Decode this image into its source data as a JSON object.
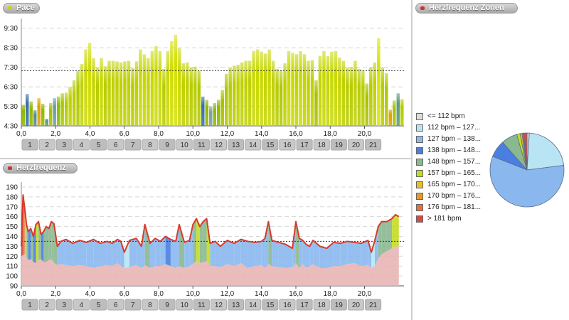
{
  "panels": {
    "pace": {
      "title": "Pace",
      "dot_color": "#c9d400"
    },
    "hr": {
      "title": "Herzfrequenz",
      "dot_color": "#cc3333"
    },
    "zones": {
      "title": "Herzfrequenz Zonen",
      "dot_color": "#cc3333"
    }
  },
  "chart_data": [
    {
      "type": "bar",
      "title": "Pace",
      "y_tick_labels": [
        "4:30",
        "5:30",
        "6:30",
        "7:30",
        "8:30",
        "9:30"
      ],
      "y_ticks_min": [
        270,
        330,
        390,
        450,
        510,
        570
      ],
      "ylim_min": [
        270,
        600
      ],
      "reference_line_min": 440,
      "x_tick_labels": [
        "0,0",
        "2,0",
        "4,0",
        "6,0",
        "8,0",
        "10,0",
        "12,0",
        "14,0",
        "16,0",
        "18,0",
        "20,0"
      ],
      "x_ticks_km": [
        0,
        2,
        4,
        6,
        8,
        10,
        12,
        14,
        16,
        18,
        20
      ],
      "xlim_km": [
        0,
        22.3
      ],
      "km_labels": [
        "1",
        "2",
        "3",
        "4",
        "5",
        "6",
        "7",
        "8",
        "9",
        "10",
        "11",
        "12",
        "13",
        "14",
        "15",
        "16",
        "17",
        "18",
        "19",
        "20",
        "21"
      ],
      "bar_width_km": 0.23,
      "values_min": [
        335,
        368,
        345,
        318,
        355,
        338,
        292,
        340,
        355,
        360,
        370,
        372,
        390,
        410,
        438,
        460,
        505,
        525,
        478,
        450,
        478,
        453,
        470,
        470,
        468,
        465,
        468,
        470,
        448,
        468,
        505,
        490,
        478,
        500,
        515,
        500,
        445,
        500,
        530,
        550,
        508,
        462,
        465,
        450,
        452,
        440,
        360,
        350,
        330,
        340,
        350,
        380,
        430,
        448,
        455,
        458,
        465,
        470,
        470,
        500,
        505,
        498,
        492,
        505,
        470,
        445,
        440,
        462,
        500,
        495,
        490,
        500,
        490,
        470,
        472,
        410,
        485,
        500,
        485,
        498,
        500,
        480,
        470,
        450,
        450,
        470,
        445,
        440,
        400,
        450,
        465,
        540,
        450,
        432,
        320,
        348,
        370,
        352
      ],
      "colors": [
        "#8fb800",
        "#3a6ea8",
        "#8fb800",
        "#5a8a8a",
        "#e0a000",
        "#8fb800",
        "#5a9a7a",
        "#a8c000",
        "#6a9ab0",
        "#8fb800",
        "#a8c800",
        "#b0cc00",
        "#c0d000",
        "#b8cc00",
        "#b0c800",
        "#c0d400",
        "#cad800",
        "#d0dc00",
        "#c4d400",
        "#b8cc00",
        "#c8d800",
        "#b8cc00",
        "#c0d000",
        "#c0d000",
        "#c0d000",
        "#c0d000",
        "#c0d000",
        "#c0d000",
        "#b8cc00",
        "#c0d000",
        "#cad800",
        "#c8d800",
        "#c4d400",
        "#c8d800",
        "#d0dc00",
        "#c8d800",
        "#b8cc00",
        "#c8d800",
        "#d0dc00",
        "#d4e000",
        "#c8d800",
        "#c0d000",
        "#c0d000",
        "#b8cc00",
        "#b8cc00",
        "#b0c800",
        "#3a6ea8",
        "#8fb800",
        "#7aa0a0",
        "#8fb800",
        "#8fb800",
        "#a8c000",
        "#b0c800",
        "#b8cc00",
        "#b8cc00",
        "#c0d000",
        "#c0d000",
        "#c0d000",
        "#c0d000",
        "#c8d800",
        "#c8d800",
        "#c8d800",
        "#c4d400",
        "#c8d800",
        "#c0d000",
        "#b8cc00",
        "#b0c800",
        "#c0d000",
        "#c8d800",
        "#c8d800",
        "#c4d400",
        "#c8d800",
        "#c4d400",
        "#c0d000",
        "#c0d000",
        "#a8c000",
        "#c4d400",
        "#c8d800",
        "#c4d400",
        "#c8d800",
        "#c8d800",
        "#c4d400",
        "#c0d000",
        "#b8cc00",
        "#b8cc00",
        "#c0d000",
        "#b8cc00",
        "#b8cc00",
        "#a8c000",
        "#b8cc00",
        "#c0d000",
        "#d8e400",
        "#b8cc00",
        "#b0c800",
        "#e0a000",
        "#a8c000",
        "#5a9a7a",
        "#b0cc00"
      ]
    },
    {
      "type": "area",
      "title": "Herzfrequenz",
      "y_tick_labels": [
        "90",
        "100",
        "110",
        "120",
        "130",
        "140",
        "150",
        "160",
        "170",
        "180",
        "190"
      ],
      "y_ticks_bpm": [
        90,
        100,
        110,
        120,
        130,
        140,
        150,
        160,
        170,
        180,
        190
      ],
      "ylim_bpm": [
        90,
        195
      ],
      "reference_line_bpm": 135,
      "x_tick_labels": [
        "0,0",
        "2,0",
        "4,0",
        "6,0",
        "8,0",
        "10,0",
        "12,0",
        "14,0",
        "16,0",
        "18,0",
        "20,0"
      ],
      "x_ticks_km": [
        0,
        2,
        4,
        6,
        8,
        10,
        12,
        14,
        16,
        18,
        20
      ],
      "xlim_km": [
        0,
        22.3
      ],
      "km_labels": [
        "1",
        "2",
        "3",
        "4",
        "5",
        "6",
        "7",
        "8",
        "9",
        "10",
        "11",
        "12",
        "13",
        "14",
        "15",
        "16",
        "17",
        "18",
        "19",
        "20",
        "21"
      ],
      "line_color": "#d83a2a",
      "x_km": [
        0,
        0.1,
        0.2,
        0.3,
        0.4,
        0.55,
        0.7,
        0.85,
        1.0,
        1.15,
        1.3,
        1.45,
        1.6,
        1.75,
        1.9,
        2.1,
        2.3,
        2.6,
        3.0,
        3.4,
        3.8,
        4.2,
        4.6,
        5.0,
        5.3,
        5.6,
        5.8,
        6.0,
        6.3,
        6.7,
        7.0,
        7.2,
        7.5,
        7.8,
        8.1,
        8.4,
        8.7,
        9.0,
        9.2,
        9.5,
        9.8,
        10.0,
        10.2,
        10.4,
        10.6,
        10.8,
        11.0,
        11.3,
        11.6,
        12.0,
        12.4,
        12.8,
        13.2,
        13.6,
        14.0,
        14.2,
        14.4,
        14.6,
        15.0,
        15.4,
        15.8,
        16.0,
        16.2,
        16.4,
        16.6,
        16.8,
        17.0,
        17.4,
        17.8,
        18.2,
        18.6,
        19.0,
        19.4,
        19.8,
        20.2,
        20.4,
        20.6,
        20.8,
        21.0,
        21.3,
        21.6,
        21.8,
        22.0
      ],
      "hr_bpm": [
        130,
        182,
        168,
        152,
        145,
        148,
        140,
        152,
        155,
        142,
        145,
        150,
        148,
        155,
        153,
        130,
        135,
        137,
        133,
        136,
        134,
        137,
        133,
        135,
        133,
        137,
        135,
        124,
        136,
        138,
        130,
        152,
        133,
        138,
        135,
        140,
        137,
        135,
        152,
        134,
        136,
        152,
        158,
        150,
        155,
        158,
        133,
        135,
        130,
        136,
        133,
        137,
        135,
        134,
        135,
        138,
        155,
        136,
        134,
        132,
        128,
        155,
        138,
        136,
        132,
        130,
        136,
        130,
        128,
        134,
        133,
        135,
        134,
        133,
        136,
        124,
        136,
        150,
        155,
        155,
        158,
        162,
        160
      ],
      "baseline_bpm": [
        120,
        121,
        122,
        119,
        116,
        117,
        114,
        113,
        116,
        117,
        114,
        114,
        116,
        117,
        113,
        111,
        112,
        111,
        110,
        111,
        110,
        108,
        110,
        111,
        110,
        113,
        110,
        108,
        109,
        111,
        108,
        111,
        108,
        110,
        110,
        112,
        110,
        108,
        110,
        108,
        110,
        112,
        115,
        113,
        114,
        115,
        110,
        110,
        109,
        112,
        110,
        113,
        108,
        110,
        111,
        108,
        112,
        110,
        109,
        108,
        109,
        113,
        108,
        112,
        108,
        110,
        112,
        108,
        108,
        110,
        110,
        112,
        113,
        110,
        111,
        108,
        110,
        118,
        122,
        125,
        128,
        130,
        130
      ],
      "zone_per_point": [
        ">181",
        "176-181",
        "157-165",
        "148-157",
        "138-148",
        "148-157",
        "138-148",
        "157-165",
        "148-157",
        "138-148",
        "148-157",
        "148-157",
        "148-157",
        "148-157",
        "148-157",
        "127-138",
        "127-138",
        "127-138",
        "127-138",
        "127-138",
        "127-138",
        "127-138",
        "127-138",
        "127-138",
        "127-138",
        "127-138",
        "127-138",
        "112-127",
        "127-138",
        "127-138",
        "127-138",
        "148-157",
        "127-138",
        "127-138",
        "127-138",
        "138-148",
        "127-138",
        "127-138",
        "148-157",
        "127-138",
        "127-138",
        "148-157",
        "157-165",
        "148-157",
        "148-157",
        "157-165",
        "127-138",
        "127-138",
        "127-138",
        "127-138",
        "127-138",
        "127-138",
        "127-138",
        "127-138",
        "127-138",
        "127-138",
        "148-157",
        "127-138",
        "127-138",
        "127-138",
        "127-138",
        "148-157",
        "127-138",
        "127-138",
        "127-138",
        "127-138",
        "127-138",
        "127-138",
        "127-138",
        "127-138",
        "127-138",
        "127-138",
        "127-138",
        "127-138",
        "127-138",
        "112-127",
        "127-138",
        "148-157",
        "148-157",
        "148-157",
        "157-165",
        "157-165",
        "157-165"
      ]
    },
    {
      "type": "pie",
      "title": "Herzfrequenz Zonen",
      "legend_position": "left",
      "legend": [
        "<= 112 bpm",
        "112 bpm – 127...",
        "127 bpm – 138...",
        "138 bpm – 148...",
        "148 bpm – 157...",
        "157 bpm – 165...",
        "165 bpm – 170...",
        "170 bpm – 176...",
        "176 bpm – 181...",
        "> 181 bpm"
      ],
      "colors": [
        "#dddddd",
        "#b8e4f4",
        "#8ab8ee",
        "#4a7ee0",
        "#8ab890",
        "#c4dc20",
        "#e8c020",
        "#e89a20",
        "#e87040",
        "#d84848"
      ],
      "values_pct": [
        1.0,
        22.0,
        58.0,
        7.5,
        7.0,
        1.5,
        0.8,
        0.5,
        0.3,
        1.4
      ]
    }
  ]
}
